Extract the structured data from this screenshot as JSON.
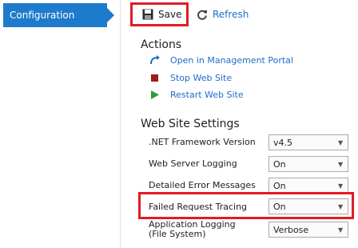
{
  "sidebar": {
    "items": [
      {
        "label": "Configuration"
      }
    ]
  },
  "toolbar": {
    "save_label": "Save",
    "refresh_label": "Refresh"
  },
  "actions": {
    "title": "Actions",
    "items": [
      {
        "label": "Open in Management Portal",
        "icon": "open-portal-icon"
      },
      {
        "label": "Stop Web Site",
        "icon": "stop-icon"
      },
      {
        "label": "Restart Web Site",
        "icon": "play-icon"
      }
    ]
  },
  "settings": {
    "title": "Web Site Settings",
    "rows": [
      {
        "label": ".NET Framework Version",
        "value": "v4.5"
      },
      {
        "label": "Web Server Logging",
        "value": "On"
      },
      {
        "label": "Detailed Error Messages",
        "value": "On"
      },
      {
        "label": "Failed Request Tracing",
        "value": "On"
      },
      {
        "label": "Application Logging\n(File System)",
        "value": "Verbose"
      }
    ]
  },
  "colors": {
    "accent": "#1e7bcc",
    "link": "#1e6ec8",
    "highlight": "#e01b24",
    "stop": "#a11a1a",
    "play": "#2e9e3a"
  }
}
